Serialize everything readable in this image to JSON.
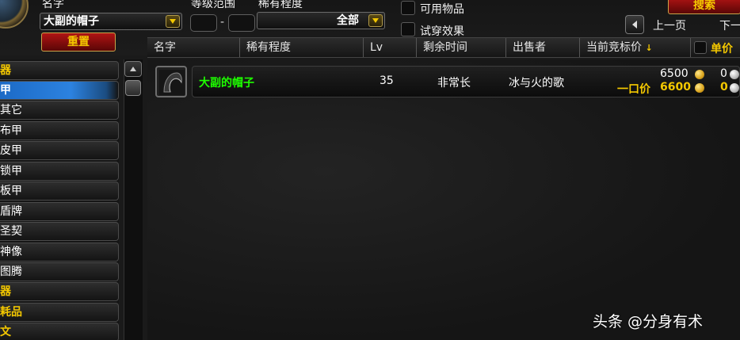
{
  "search": {
    "name_label": "名字",
    "name_value": "大副的帽子",
    "level_label": "等级范围",
    "level_dash": "-",
    "rarity_label": "稀有程度",
    "rarity_value": "全部",
    "usable_label": "可用物品",
    "preview_label": "试穿效果",
    "reset_label": "重置",
    "search_label": "搜索",
    "prev_page_label": "上一页",
    "next_page_label": "下一"
  },
  "columns": {
    "name": "名字",
    "rarity": "稀有程度",
    "level": "Lv",
    "time_left": "剩余时间",
    "seller": "出售者",
    "current_bid": "当前竞标价",
    "sort_arrow": "↓",
    "unit_price": "单价"
  },
  "sidebar": {
    "items": [
      {
        "label": "器",
        "type": "category"
      },
      {
        "label": "甲",
        "type": "active"
      },
      {
        "label": "其它",
        "type": "sub"
      },
      {
        "label": "布甲",
        "type": "sub"
      },
      {
        "label": "皮甲",
        "type": "sub"
      },
      {
        "label": "锁甲",
        "type": "sub"
      },
      {
        "label": "板甲",
        "type": "sub"
      },
      {
        "label": "盾牌",
        "type": "sub"
      },
      {
        "label": "圣契",
        "type": "sub"
      },
      {
        "label": "神像",
        "type": "sub"
      },
      {
        "label": "图腾",
        "type": "sub"
      },
      {
        "label": "器",
        "type": "category"
      },
      {
        "label": "耗品",
        "type": "category"
      },
      {
        "label": "文",
        "type": "category"
      }
    ]
  },
  "results": [
    {
      "name": "大副的帽子",
      "level": "35",
      "time_left": "非常长",
      "seller": "冰与火的歌",
      "bid_gold": "6500",
      "bid_silver": "0",
      "buyout_label": "一口价",
      "buyout_gold": "6600",
      "buyout_silver": "0"
    }
  ],
  "watermark": "头条 @分身有术",
  "colors": {
    "gold": "#f4c800",
    "item_uncommon": "#1eff00",
    "active_blue": "#2c82e0"
  }
}
